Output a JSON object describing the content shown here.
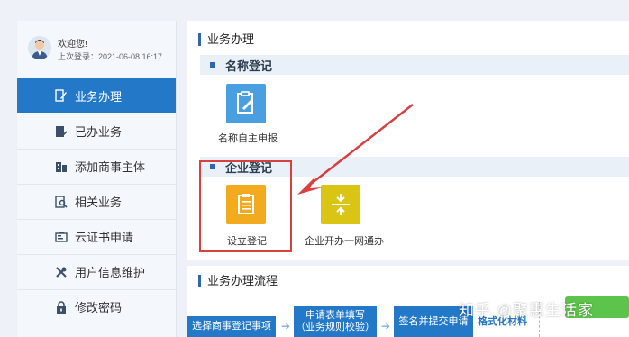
{
  "user": {
    "welcome": "欢迎您!",
    "last_login": "上次登录：2021-06-08 16:17"
  },
  "sidebar": {
    "items": [
      {
        "label": "业务办理",
        "icon": "pen-icon",
        "active": true
      },
      {
        "label": "已办业务",
        "icon": "document-check-icon"
      },
      {
        "label": "添加商事主体",
        "icon": "building-icon"
      },
      {
        "label": "相关业务",
        "icon": "search-document-icon"
      },
      {
        "label": "云证书申请",
        "icon": "certificate-icon"
      },
      {
        "label": "用户信息维护",
        "icon": "tools-icon"
      },
      {
        "label": "修改密码",
        "icon": "lock-icon"
      }
    ]
  },
  "main": {
    "business_title": "业务办理",
    "name_reg": {
      "header": "名称登记",
      "tiles": [
        {
          "label": "名称自主申报",
          "color": "#4a9fe0",
          "icon": "edit-form-icon"
        }
      ]
    },
    "enterprise_reg": {
      "header": "企业登记",
      "tiles": [
        {
          "label": "设立登记",
          "color": "#f2ab1e",
          "icon": "clipboard-icon"
        },
        {
          "label": "企业开办一网通办",
          "color": "#dac514",
          "icon": "merge-icon"
        }
      ]
    },
    "process_title": "业务办理流程",
    "process_steps": [
      {
        "text": "选择商事登记事项"
      },
      {
        "text": "申请表单填写",
        "subtext": "（业务规则校验）"
      },
      {
        "text": "签名并提交申请"
      }
    ],
    "process_tag": "格式化材料"
  },
  "watermark": "知乎 @聚惠生活家",
  "colors": {
    "accent": "#2478c8",
    "highlight": "#d94040",
    "arrow": "#d94040"
  }
}
